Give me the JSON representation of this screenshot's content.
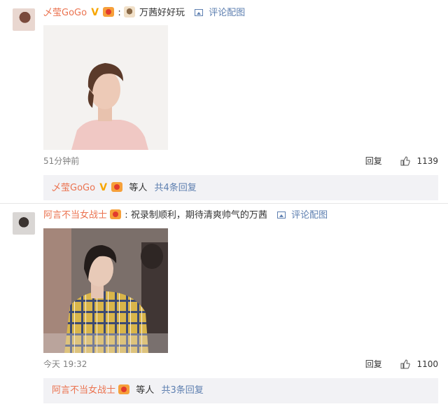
{
  "comments": [
    {
      "username": "乄莹GoGo",
      "verified_badge": "V",
      "text": "万茜好好玩",
      "separator": ":",
      "pic_link": "评论配图",
      "time": "51分钟前",
      "reply_label": "回复",
      "likes": "1139",
      "sub": {
        "username": "乄莹GoGo",
        "etc": "等人",
        "more": "共4条回复"
      }
    },
    {
      "username": "阿言不当女战士",
      "text": "祝录制顺利，期待清爽帅气的万茜",
      "separator": ":",
      "pic_link": "评论配图",
      "time": "今天 19:32",
      "reply_label": "回复",
      "likes": "1100",
      "sub": {
        "username": "阿言不当女战士",
        "etc": "等人",
        "more": "共3条回复"
      }
    }
  ],
  "colors": {
    "username": "#eb7350",
    "link": "#5d7fb0",
    "subbar_bg": "#f2f2f5",
    "badge": "#f7a600"
  },
  "icons": [
    "avatar",
    "verified-icon",
    "medal-icon",
    "picture-icon",
    "thumbs-up-icon"
  ]
}
